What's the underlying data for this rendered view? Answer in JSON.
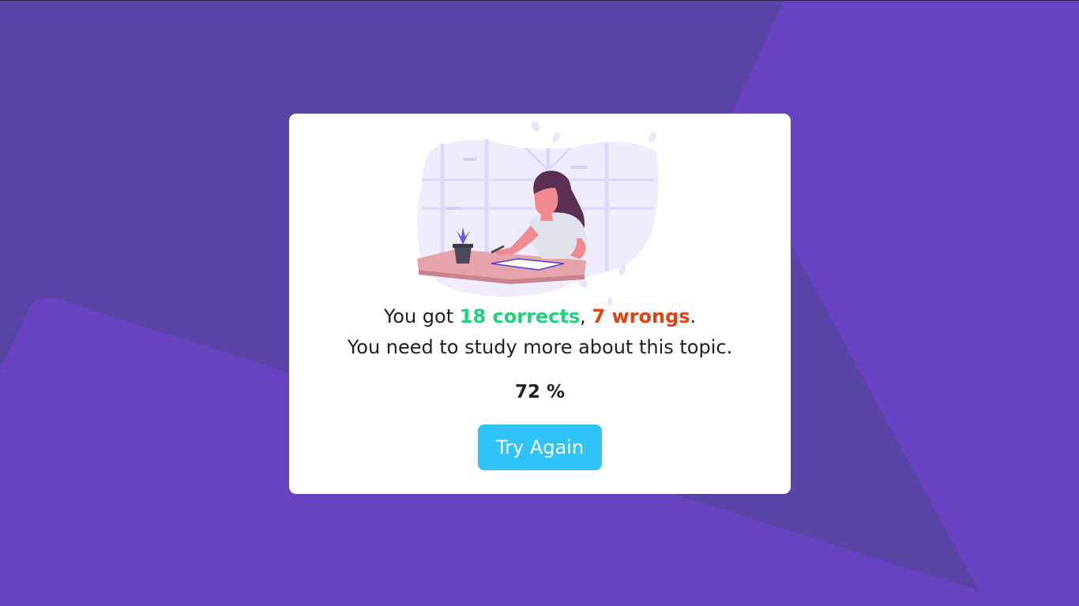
{
  "background": {
    "base_color": "#5a44a6",
    "accent_color": "#6644c2"
  },
  "result": {
    "prefix": "You got ",
    "correct_text": "18 corrects",
    "separator": ", ",
    "wrong_text": "7 wrongs",
    "suffix": ".",
    "message": "You need to study more about this topic.",
    "percent_text": "72 %",
    "correct_count": 18,
    "wrong_count": 7,
    "correct_color": "#1fd17a",
    "wrong_color": "#dc4411"
  },
  "actions": {
    "try_again_label": "Try Again",
    "button_color": "#2ec4fb"
  },
  "illustration": {
    "icon": "woman-studying-illustration"
  }
}
